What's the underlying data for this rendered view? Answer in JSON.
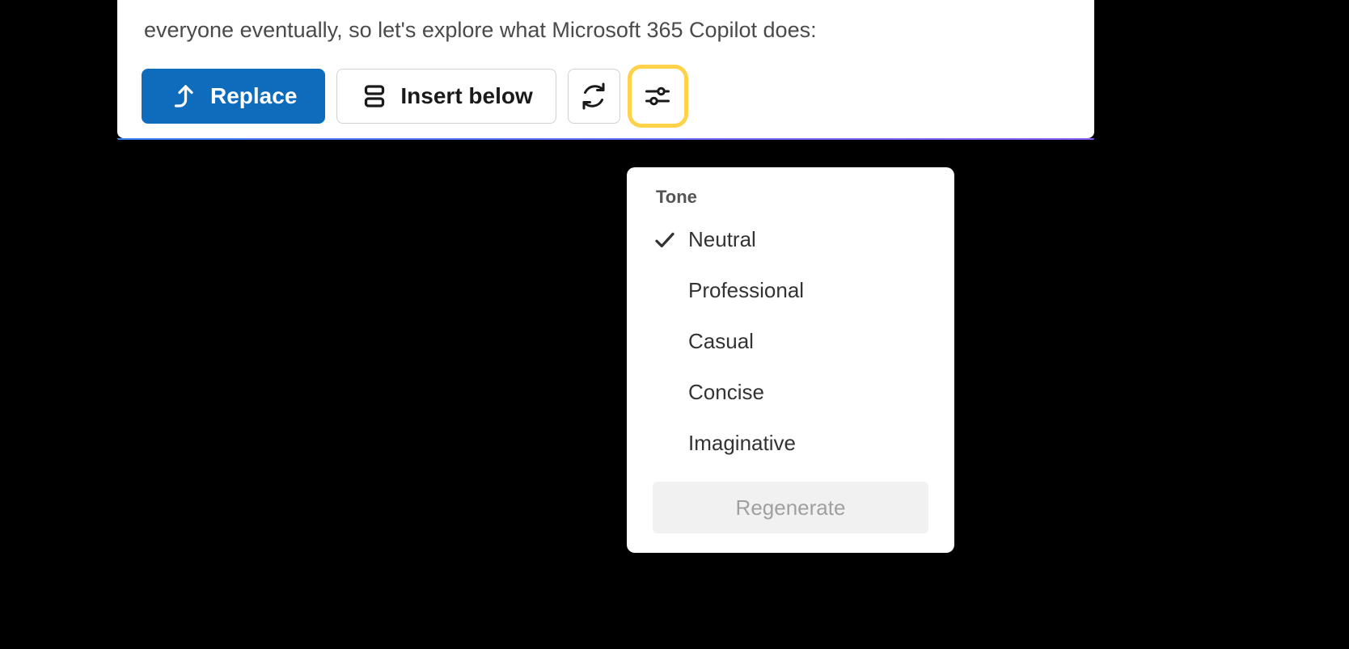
{
  "panel": {
    "body_text": "everyone eventually, so let's explore what Microsoft 365 Copilot does:"
  },
  "toolbar": {
    "replace_label": "Replace",
    "insert_below_label": "Insert below"
  },
  "tone_menu": {
    "header": "Tone",
    "items": [
      {
        "label": "Neutral",
        "selected": true
      },
      {
        "label": "Professional",
        "selected": false
      },
      {
        "label": "Casual",
        "selected": false
      },
      {
        "label": "Concise",
        "selected": false
      },
      {
        "label": "Imaginative",
        "selected": false
      }
    ],
    "regenerate_label": "Regenerate"
  }
}
